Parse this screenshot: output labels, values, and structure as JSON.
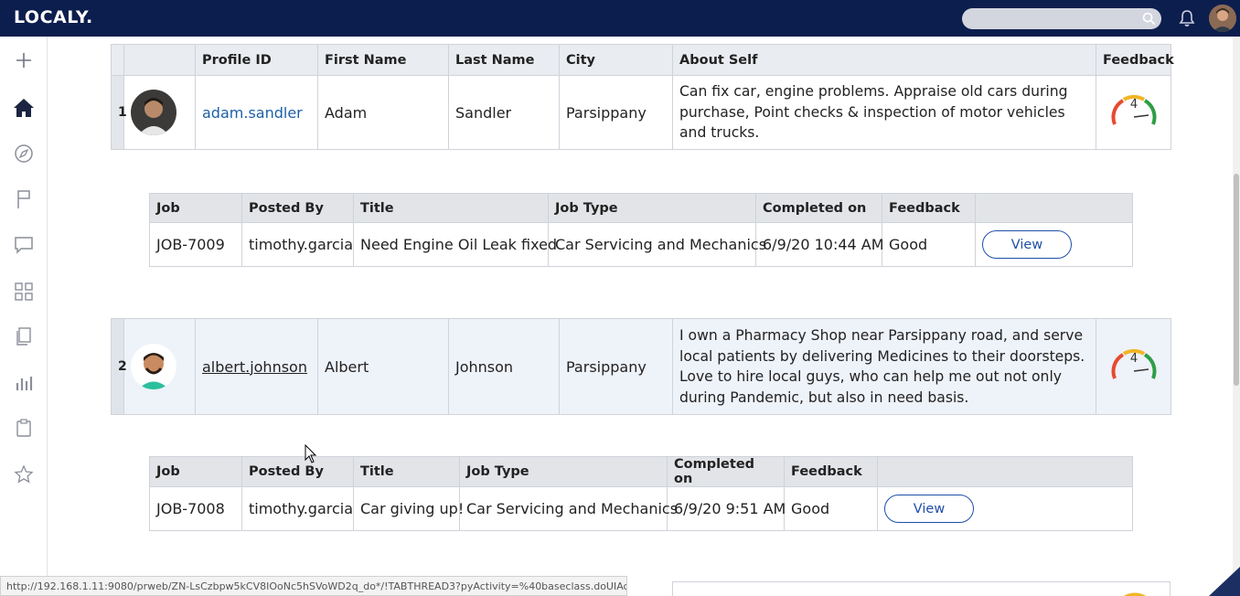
{
  "app": {
    "logo": "LOCALY.",
    "search_placeholder": ""
  },
  "sidebar": {
    "items": [
      "add-icon",
      "home-icon",
      "explore-icon",
      "flag-icon",
      "message-icon",
      "apps-icon",
      "documents-icon",
      "reports-icon",
      "clipboard-icon",
      "star-icon"
    ]
  },
  "profiles": {
    "headers": [
      "",
      "",
      "Profile ID",
      "First Name",
      "Last Name",
      "City",
      "About Self",
      "Feedback"
    ],
    "rows": [
      {
        "num": "1",
        "profile_id": "adam.sandler",
        "first": "Adam",
        "last": "Sandler",
        "city": "Parsippany",
        "about": "Can fix car, engine problems. Appraise old cars during purchase, Point checks & inspection of motor vehicles and trucks.",
        "feedback": "4"
      },
      {
        "num": "2",
        "profile_id": "albert.johnson",
        "first": "Albert",
        "last": "Johnson",
        "city": "Parsippany",
        "about": "I own a Pharmacy Shop near Parsippany road, and serve local patients by delivering Medicines to their doorsteps. Love to hire local guys, who can help me out not only during Pandemic, but also in need basis.",
        "feedback": "4"
      }
    ]
  },
  "jobs_headers": [
    "Job",
    "Posted By",
    "Title",
    "Job Type",
    "Completed on",
    "Feedback",
    ""
  ],
  "jobs": [
    {
      "job": "JOB-7009",
      "posted_by": "timothy.garcia",
      "title": "Need Engine Oil Leak fixed",
      "type": "Car Servicing and Mechanics",
      "completed": "6/9/20 10:44 AM",
      "feedback": "Good",
      "action": "View"
    },
    {
      "job": "JOB-7008",
      "posted_by": "timothy.garcia",
      "title": "Car giving up!",
      "type": "Car Servicing and Mechanics",
      "completed": "6/9/20 9:51 AM",
      "feedback": "Good",
      "action": "View"
    }
  ],
  "status_url": "http://192.168.1.11:9080/prweb/ZN-LsCzbpw5kCV8IOoNc5hSVoWD2q_do*/!TABTHREAD3?pyActivity=%40baseclass.doUIAction"
}
